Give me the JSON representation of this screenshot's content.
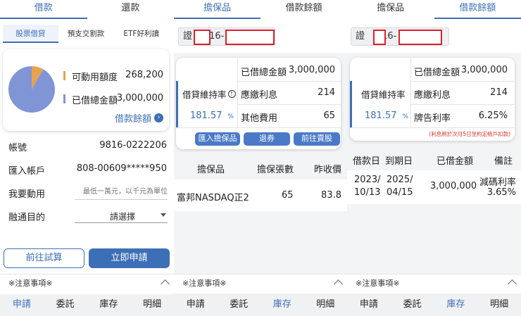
{
  "p1": {
    "top_tabs": [
      "借款",
      "還款"
    ],
    "sub_tabs": [
      "股票借貸",
      "預支交割款",
      "ETF好利讀"
    ],
    "legend": {
      "available_label": "可動用額度",
      "available_value": "268,200",
      "borrowed_label": "已借總金額",
      "borrowed_value": "3,000,000",
      "available_color": "#e9a24c",
      "borrowed_color": "#8095d6"
    },
    "chart_data": {
      "type": "pie",
      "categories": [
        "可動用額度",
        "已借總金額"
      ],
      "values": [
        268200,
        3000000
      ]
    },
    "balance_link": "借款餘額",
    "rows": {
      "account_label": "帳號",
      "account_value": "9816-0222206",
      "remit_label": "匯入帳戶",
      "remit_value": "808-00609*****950",
      "use_label": "我要動用",
      "use_placeholder": "最低一萬元，以千元為單位",
      "purpose_label": "融通目的",
      "purpose_value": "請選擇"
    },
    "btn_calc": "前往試算",
    "btn_apply": "立即申請"
  },
  "p2": {
    "top_tabs": [
      "擔保品",
      "借款餘額"
    ],
    "account_prefix": "證",
    "account_mid": "16-",
    "ratio_label": "借貸維持率",
    "ratio_value": "181.57",
    "ratio_unit": "%",
    "rows": [
      {
        "label": "已借總金額",
        "value": "3,000,000"
      },
      {
        "label": "應繳利息",
        "value": "214"
      },
      {
        "label": "其他費用",
        "value": "65"
      }
    ],
    "buttons": [
      "匯入擔保品",
      "退券",
      "前往賣股"
    ],
    "table_headers": [
      "擔保品",
      "擔保張數",
      "昨收價"
    ],
    "table_rows": [
      {
        "name": "富邦NASDAQ正2",
        "qty": "65",
        "price": "83.8"
      }
    ]
  },
  "p3": {
    "top_tabs": [
      "擔保品",
      "借款餘額"
    ],
    "account_prefix": "證",
    "account_mid": "16-",
    "ratio_label": "借貸維持率",
    "ratio_value": "181.57",
    "ratio_unit": "%",
    "rows": [
      {
        "label": "已借總金額",
        "value": "3,000,000"
      },
      {
        "label": "應繳利息",
        "value": "214"
      },
      {
        "label": "牌告利率",
        "value": "6.25%"
      }
    ],
    "note": "(利息將於次月5日至約定帳戶扣款)",
    "table_headers": [
      "借款日",
      "到期日",
      "已借金額",
      "備註"
    ],
    "table_rows": [
      {
        "start_line1": "2023/",
        "start_line2": "10/13",
        "end_line1": "2025/",
        "end_line2": "04/15",
        "amount": "3,000,000",
        "note_line1": "減碼利率",
        "note_line2": "3.65%"
      }
    ]
  },
  "common": {
    "notice": "※注意事項※",
    "nav": [
      "申請",
      "委託",
      "庫存",
      "明細"
    ]
  }
}
